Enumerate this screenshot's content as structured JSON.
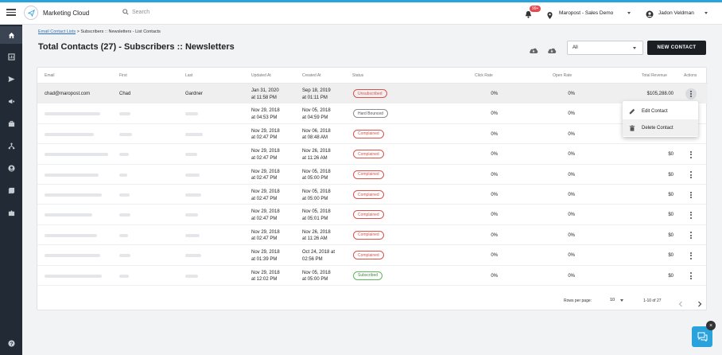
{
  "app": {
    "name": "Marketing Cloud",
    "search_placeholder": "Search",
    "notification_badge": "99+",
    "account": "Maropost - Sales Demo",
    "user": "Jadon Veldman"
  },
  "breadcrumb": {
    "link": "Email Contact Lists",
    "rest": " > Subscribers :: Newsletters - List Contacts"
  },
  "page_title": "Total Contacts (27) - Subscribers :: Newsletters",
  "filter_value": "All",
  "new_contact_label": "NEW CONTACT",
  "columns": {
    "email": "Email",
    "first": "First",
    "last": "Last",
    "updated": "Updated At",
    "created": "Created At",
    "status": "Status",
    "click": "Click Rate",
    "open": "Open Rate",
    "revenue": "Total Revenue",
    "actions": "Actions"
  },
  "rows": [
    {
      "email": "chad@maropost.com",
      "first": "Chad",
      "last": "Gardner",
      "updated_date": "Jan 31, 2020",
      "updated_time": "at 11:58 PM",
      "created_date": "Sep 18, 2019",
      "created_time": "at 01:11 PM",
      "status": "Unsubscribed",
      "status_kind": "red",
      "click": "0%",
      "open": "0%",
      "revenue": "$105,288.00"
    },
    {
      "email": "",
      "first": "",
      "last": "",
      "updated_date": "Nov 29, 2018",
      "updated_time": "at 04:53 PM",
      "created_date": "Nov 05, 2018",
      "created_time": "at 04:59 PM",
      "status": "Hard Bounced",
      "status_kind": "gray",
      "click": "0%",
      "open": "0%",
      "revenue": ""
    },
    {
      "email": "",
      "first": "",
      "last": "",
      "updated_date": "Nov 29, 2018",
      "updated_time": "at 02:47 PM",
      "created_date": "Nov 06, 2018",
      "created_time": "at 08:48 AM",
      "status": "Complained",
      "status_kind": "red",
      "click": "0%",
      "open": "0%",
      "revenue": ""
    },
    {
      "email": "",
      "first": "",
      "last": "",
      "updated_date": "Nov 29, 2018",
      "updated_time": "at 02:47 PM",
      "created_date": "Nov 26, 2018",
      "created_time": "at 11:26 AM",
      "status": "Complained",
      "status_kind": "red",
      "click": "0%",
      "open": "0%",
      "revenue": "$0"
    },
    {
      "email": "",
      "first": "",
      "last": "",
      "updated_date": "Nov 29, 2018",
      "updated_time": "at 02:47 PM",
      "created_date": "Nov 05, 2018",
      "created_time": "at 05:00 PM",
      "status": "Complained",
      "status_kind": "red",
      "click": "0%",
      "open": "0%",
      "revenue": "$0"
    },
    {
      "email": "",
      "first": "",
      "last": "",
      "updated_date": "Nov 29, 2018",
      "updated_time": "at 02:47 PM",
      "created_date": "Nov 05, 2018",
      "created_time": "at 05:00 PM",
      "status": "Complained",
      "status_kind": "red",
      "click": "0%",
      "open": "0%",
      "revenue": "$0"
    },
    {
      "email": "",
      "first": "",
      "last": "",
      "updated_date": "Nov 29, 2018",
      "updated_time": "at 02:47 PM",
      "created_date": "Nov 05, 2018",
      "created_time": "at 05:01 PM",
      "status": "Complained",
      "status_kind": "red",
      "click": "0%",
      "open": "0%",
      "revenue": "$0"
    },
    {
      "email": "",
      "first": "",
      "last": "",
      "updated_date": "Nov 29, 2018",
      "updated_time": "at 02:47 PM",
      "created_date": "Nov 26, 2018",
      "created_time": "at 11:26 AM",
      "status": "Complained",
      "status_kind": "red",
      "click": "0%",
      "open": "0%",
      "revenue": "$0"
    },
    {
      "email": "",
      "first": "",
      "last": "",
      "updated_date": "Nov 29, 2018",
      "updated_time": "at 01:39 PM",
      "created_date": "Oct 24, 2018 at",
      "created_time": "02:56 PM",
      "status": "Complained",
      "status_kind": "red",
      "click": "0%",
      "open": "0%",
      "revenue": "$0"
    },
    {
      "email": "",
      "first": "",
      "last": "",
      "updated_date": "Nov 29, 2018",
      "updated_time": "at 12:02 PM",
      "created_date": "Nov 05, 2018",
      "created_time": "at 05:00 PM",
      "status": "Subscribed",
      "status_kind": "green",
      "click": "0%",
      "open": "0%",
      "revenue": "$0"
    }
  ],
  "menu": {
    "edit": "Edit Contact",
    "delete": "Delete Contact"
  },
  "pagination": {
    "rows_per_page_label": "Rows per page:",
    "rows_per_page": "10",
    "range": "1-10 of 27"
  },
  "colors": {
    "accent": "#2aa3dd",
    "sidebar": "#222a35",
    "status_red": "#d9534f",
    "status_green": "#5cb85c"
  }
}
